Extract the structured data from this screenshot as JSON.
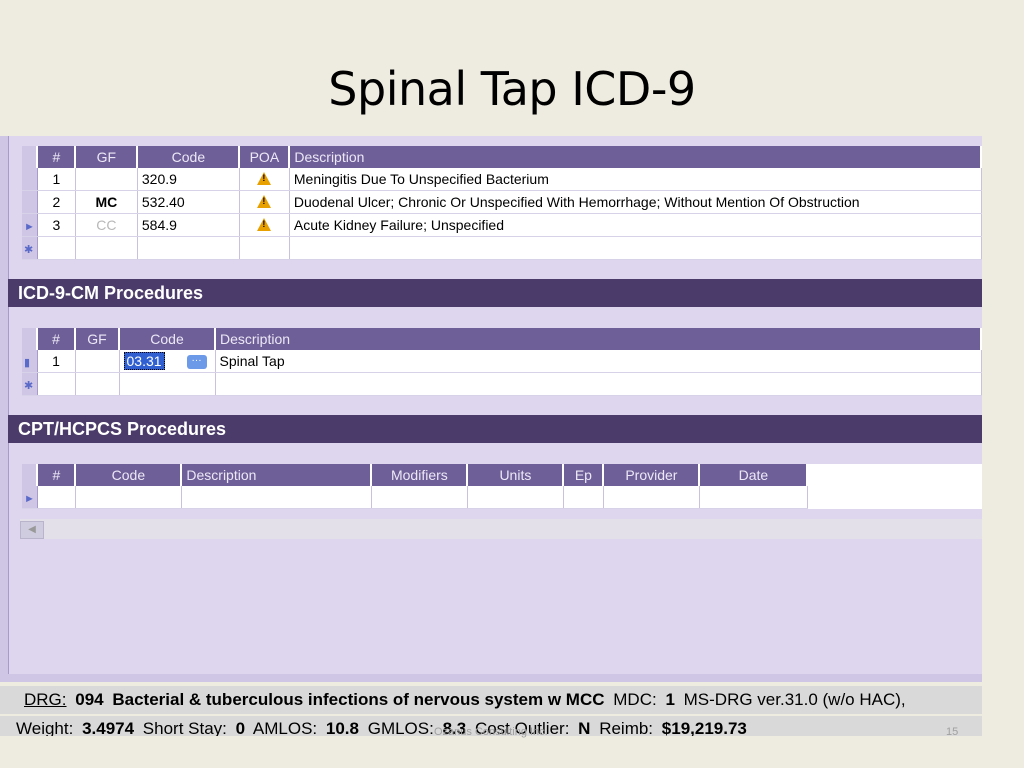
{
  "slide": {
    "title": "Spinal Tap ICD-9",
    "watermark": "Ozanus Consulting Inc.",
    "page_number": "15"
  },
  "diagnoses": {
    "headers": {
      "num": "#",
      "gf": "GF",
      "code": "Code",
      "poa": "POA",
      "description": "Description"
    },
    "rows": [
      {
        "num": "1",
        "gf": "",
        "code": "320.9",
        "poa_icon": "warning-icon",
        "description": "Meningitis Due To Unspecified Bacterium"
      },
      {
        "num": "2",
        "gf": "MC",
        "code": "532.40",
        "poa_icon": "warning-icon",
        "description": "Duodenal Ulcer; Chronic Or Unspecified With Hemorrhage; Without Mention Of Obstruction"
      },
      {
        "num": "3",
        "gf": "CC",
        "code": "584.9",
        "poa_icon": "warning-icon",
        "description": "Acute Kidney Failure; Unspecified"
      }
    ]
  },
  "icd_procedures": {
    "title": "ICD-9-CM Procedures",
    "headers": {
      "num": "#",
      "gf": "GF",
      "code": "Code",
      "description": "Description"
    },
    "rows": [
      {
        "num": "1",
        "gf": "",
        "code": "03.31",
        "description": "Spinal Tap"
      }
    ]
  },
  "cpt_procedures": {
    "title": "CPT/HCPCS Procedures",
    "headers": {
      "num": "#",
      "code": "Code",
      "description": "Description",
      "modifiers": "Modifiers",
      "units": "Units",
      "ep": "Ep",
      "provider": "Provider",
      "date": "Date"
    }
  },
  "drg": {
    "label": "DRG:",
    "number": "094",
    "description": "Bacterial & tuberculous infections of nervous system w MCC",
    "mdc_label": "MDC:",
    "mdc": "1",
    "version": "MS-DRG ver.31.0 (w/o HAC),"
  },
  "metrics": {
    "weight_label": "Weight:",
    "weight": "3.4974",
    "short_stay_label": "Short Stay:",
    "short_stay": "0",
    "amlos_label": "AMLOS:",
    "amlos": "10.8",
    "gmlos_label": "GMLOS:",
    "gmlos": "8.3",
    "cost_outlier_label": "Cost Outlier:",
    "cost_outlier": "N",
    "reimb_label": "Reimb:",
    "reimb": "$19,219.73"
  }
}
